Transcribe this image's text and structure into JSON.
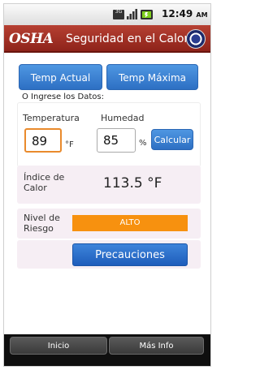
{
  "status_bar": {
    "network": "3G",
    "time": "12:49",
    "ampm": "AM",
    "icons": [
      "network-3g-icon",
      "signal-icon",
      "battery-icon"
    ]
  },
  "header": {
    "logo": "OSHA",
    "title": "Seguridad en el Calor",
    "seal_icon": "dol-seal-icon",
    "color": "#9c2a1f"
  },
  "buttons": {
    "temp_actual": "Temp Actual",
    "temp_maxima": "Temp Máxima",
    "calcular": "Calcular",
    "precauciones": "Precauciones"
  },
  "form": {
    "prompt": "O Ingrese los Datos:",
    "temperature_label": "Temperatura",
    "temperature_value": "89",
    "temperature_unit": "°F",
    "humidity_label": "Humedad",
    "humidity_value": "85",
    "humidity_unit": "%"
  },
  "results": {
    "index_label": "Índice de Calor",
    "index_value": "113.5 °F",
    "risk_label": "Nivel de Riesgo",
    "risk_value": "ALTO",
    "risk_color": "#f7910f"
  },
  "bottom_nav": {
    "inicio": "Inicio",
    "mas_info": "Más Info"
  }
}
